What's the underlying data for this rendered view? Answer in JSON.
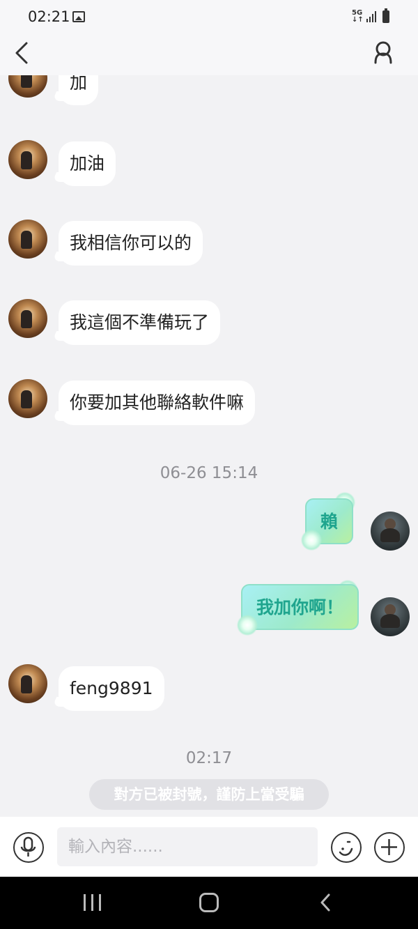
{
  "status_bar": {
    "time": "02:21",
    "network_top": "5G",
    "network_bottom": "↓↑"
  },
  "header": {
    "back_icon": "chevron-left-icon",
    "profile_icon": "person-icon"
  },
  "messages_incoming_top": [
    {
      "text": "加"
    },
    {
      "text": "加油"
    },
    {
      "text": "我相信你可以的"
    },
    {
      "text": "我這個不準備玩了"
    },
    {
      "text": "你要加其他聯絡軟件嘛"
    }
  ],
  "timestamp_1": "06-26 15:14",
  "messages_outgoing": [
    {
      "text": "賴"
    },
    {
      "text": "我加你啊！"
    }
  ],
  "message_incoming_last": {
    "text": "feng9891"
  },
  "timestamp_2": "02:17",
  "system_notice": "對方已被封號，謹防上當受騙",
  "input_bar": {
    "placeholder": "輸入內容......",
    "value": "",
    "mic_icon": "microphone-icon",
    "emoji_icon": "emoji-icon",
    "add_icon": "plus-circle-icon"
  },
  "nav_bar": {
    "recents_icon": "recents-icon",
    "home_icon": "home-icon",
    "back_icon": "back-icon"
  },
  "colors": {
    "background": "#f2f2f4",
    "incoming_bubble": "#ffffff",
    "outgoing_text": "#1fa58e",
    "outgoing_bubble_start": "#a8f0f4",
    "outgoing_bubble_end": "#b9f0a0",
    "timestamp": "#8e8e93"
  }
}
